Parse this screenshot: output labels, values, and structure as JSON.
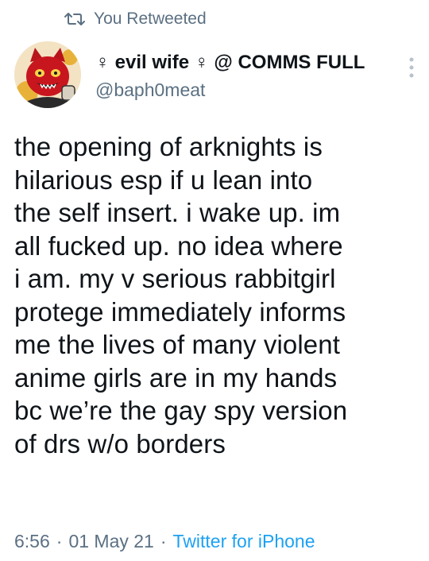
{
  "retweet": {
    "icon": "retweet-icon",
    "label": "You Retweeted"
  },
  "author": {
    "avatar_icon": "red-cat-demon-avatar",
    "display_name": "♀ evil wife ♀ @ COMMS FULL",
    "handle": "@baph0meat"
  },
  "menu": {
    "icon": "more-vertical-icon"
  },
  "tweet": {
    "text": "the opening of arknights is\nhilarious esp if u lean into\nthe self insert. i wake up. im\nall fucked up. no idea where\ni am. my v serious rabbitgirl\nprotege immediately informs\nme the lives of many violent\nanime girls are in my hands\nbc we’re the gay spy version\nof drs w/o borders"
  },
  "meta": {
    "time": "6:56",
    "separator": "·",
    "date": "01 May 21",
    "source": "Twitter for iPhone"
  },
  "colors": {
    "text": "#0f1419",
    "secondary": "#5b7083",
    "link": "#1da1f2"
  }
}
